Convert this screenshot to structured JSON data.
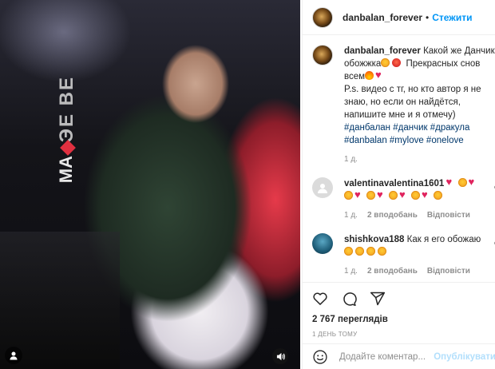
{
  "post": {
    "author": "danbalan_forever",
    "follow_label": "Стежити",
    "separator": "•"
  },
  "caption": {
    "author": "danbalan_forever",
    "text1": "Какой же Данчик обожжка",
    "text2": " Прекрасных снов всем",
    "text3": "P.s. видео с тг, но кто автор я не знаю, но если он найдётся, напишите мне и я отмечу)",
    "hashtags": "#данбалан #данчик #дракула #danbalan #mylove #onelove",
    "time": "1 д."
  },
  "comments": [
    {
      "author": "valentinavalentina1601",
      "time": "1 д.",
      "likes": "2 вподобань",
      "reply": "Відповісти"
    },
    {
      "author": "shishkova188",
      "text": "Как я его обожаю",
      "time": "1 д.",
      "likes": "2 вподобань",
      "reply": "Відповісти"
    }
  ],
  "stats": {
    "views": "2 767 переглядів",
    "posted": "1 ДЕНЬ ТОМУ"
  },
  "composer": {
    "placeholder": "Додайте коментар...",
    "publish": "Опублікувати"
  },
  "video_sign": "ЭЕ ВЕ",
  "video_sign2": "MA",
  "colors": {
    "accent": "#0095f6",
    "muted": "#8e8e8e",
    "link": "#00376b"
  }
}
